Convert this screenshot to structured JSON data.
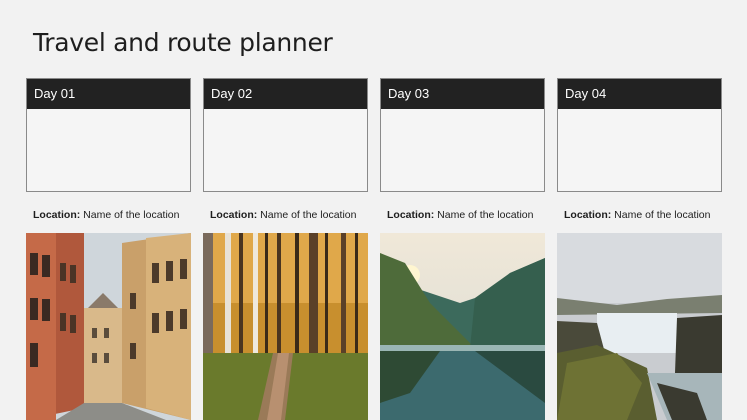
{
  "page": {
    "title": "Travel and route planner"
  },
  "days": [
    {
      "label": "Day 01",
      "location_label": "Location:",
      "location_value": "Name of the location",
      "image": "old-town-street-photo"
    },
    {
      "label": "Day 02",
      "location_label": "Location:",
      "location_value": "Name of the location",
      "image": "forest-path-photo"
    },
    {
      "label": "Day 03",
      "location_label": "Location:",
      "location_value": "Name of the location",
      "image": "fjord-lake-photo"
    },
    {
      "label": "Day 04",
      "location_label": "Location:",
      "location_value": "Name of the location",
      "image": "waterfall-canyon-photo"
    }
  ],
  "colors": {
    "header_bg": "#222222",
    "page_bg": "#f2f2f2",
    "card_border": "#8a8a8a"
  }
}
